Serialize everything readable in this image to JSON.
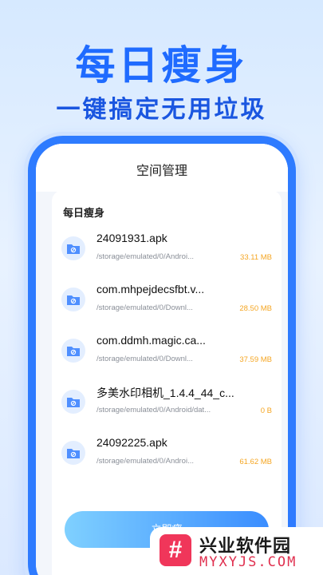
{
  "hero": {
    "title": "每日瘦身",
    "subtitle": "一键搞定无用垃圾"
  },
  "screen": {
    "header_title": "空间管理",
    "card_title": "每日瘦身",
    "files": [
      {
        "name": "24091931.apk",
        "path": "/storage/emulated/0/Androi...",
        "size": "33.11 MB",
        "icon": "folder-icon"
      },
      {
        "name": "com.mhpejdecsfbt.v...",
        "path": "/storage/emulated/0/Downl...",
        "size": "28.50 MB",
        "icon": "folder-icon"
      },
      {
        "name": "com.ddmh.magic.ca...",
        "path": "/storage/emulated/0/Downl...",
        "size": "37.59 MB",
        "icon": "folder-icon"
      },
      {
        "name": "多美水印相机_1.4.4_44_c...",
        "path": "/storage/emulated/0/Android/dat...",
        "size": "0 B",
        "icon": "folder-icon"
      },
      {
        "name": "24092225.apk",
        "path": "/storage/emulated/0/Androi...",
        "size": "61.62 MB",
        "icon": "folder-icon"
      }
    ],
    "action_label": "立即瘦"
  },
  "watermark": {
    "logo_glyph": "#",
    "title": "兴业软件园",
    "url": "MYXYJS.COM"
  },
  "colors": {
    "accent": "#2e7bff",
    "size_text": "#f5a623",
    "watermark_logo": "#f0365a"
  }
}
